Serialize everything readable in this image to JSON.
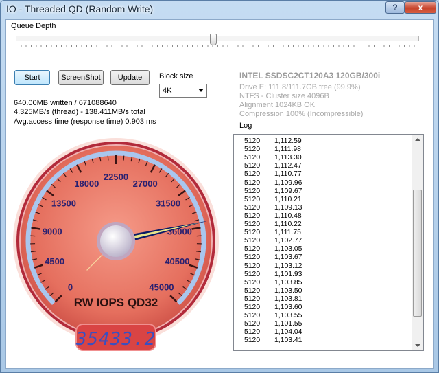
{
  "window": {
    "title": "IO - Threaded QD (Random Write)",
    "help_glyph": "?",
    "close_glyph": "x"
  },
  "queue": {
    "label": "Queue Depth",
    "position": 0.49
  },
  "buttons": {
    "start": "Start",
    "screenshot": "ScreenShot",
    "update": "Update"
  },
  "block": {
    "label": "Block size",
    "value": "4K"
  },
  "stats": {
    "line1": "640.00MB written / 671088640",
    "line2": "4.325MB/s (thread) - 138.411MB/s total",
    "line3": "Avg.access time (response time) 0.903 ms"
  },
  "drive": {
    "name": "INTEL SSDSC2CT120A3 120GB/300i",
    "line1": "Drive E: 111.8/111.7GB free (99.9%)",
    "line2": "NTFS - Cluster size 4096B",
    "line3": "Alignment 1024KB OK",
    "line4": "Compression 100% (Incompressible)"
  },
  "log": {
    "label": "Log",
    "rows": [
      [
        "5120",
        "1,112.59"
      ],
      [
        "5120",
        "1,111.98"
      ],
      [
        "5120",
        "1,113.30"
      ],
      [
        "5120",
        "1,112.47"
      ],
      [
        "5120",
        "1,110.77"
      ],
      [
        "5120",
        "1,109.96"
      ],
      [
        "5120",
        "1,109.67"
      ],
      [
        "5120",
        "1,110.21"
      ],
      [
        "5120",
        "1,109.13"
      ],
      [
        "5120",
        "1,110.48"
      ],
      [
        "5120",
        "1,110.22"
      ],
      [
        "5120",
        "1,111.75"
      ],
      [
        "5120",
        "1,102.77"
      ],
      [
        "5120",
        "1,103.05"
      ],
      [
        "5120",
        "1,103.67"
      ],
      [
        "5120",
        "1,103.12"
      ],
      [
        "5120",
        "1,101.93"
      ],
      [
        "5120",
        "1,103.85"
      ],
      [
        "5120",
        "1,103.50"
      ],
      [
        "5120",
        "1,103.81"
      ],
      [
        "5120",
        "1,103.60"
      ],
      [
        "5120",
        "1,103.55"
      ],
      [
        "5120",
        "1,101.55"
      ],
      [
        "5120",
        "1,104.04"
      ],
      [
        "5120",
        "1,103.41"
      ]
    ]
  },
  "gauge": {
    "title": "RW IOPS QD32",
    "readout": "35433.2",
    "needle_value": 35433.2,
    "min": 0,
    "max": 45000,
    "ticks": [
      "0",
      "4500",
      "9000",
      "13500",
      "18000",
      "22500",
      "27000",
      "31500",
      "36000",
      "40500",
      "45000"
    ],
    "colors": {
      "face": "#e56f5e",
      "rim": "#b22a3a",
      "arc": "#a9c6ee",
      "needle": "#0a1a66",
      "needle_tip": "#e8e48a",
      "readout_bg": "#d94444",
      "digits": "#3a4fc0"
    }
  }
}
